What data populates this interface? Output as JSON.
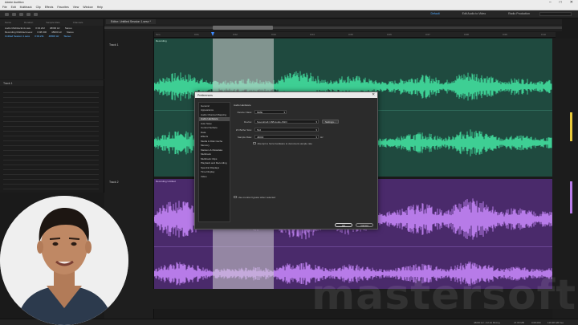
{
  "app": {
    "window_title": "Adobe Audition",
    "menu": [
      "File",
      "Edit",
      "Multitrack",
      "Clip",
      "Effects",
      "Favorites",
      "View",
      "Window",
      "Help"
    ],
    "workspaces": [
      "Default",
      "Edit Audio to Video",
      "Radio Production"
    ]
  },
  "files_panel": {
    "columns": [
      "Name",
      "Duration",
      "Sample Rate",
      "Channels"
    ],
    "rows": [
      {
        "name": "Audio Multitrackmix.wav",
        "duration": "0:04.222",
        "rate": "48000 Hz",
        "channels": "Stereo"
      },
      {
        "name": "Recording Multitrack.sesx",
        "duration": "0:08.000",
        "rate": "48000 Hz",
        "channels": "Stereo"
      },
      {
        "name": "Untitled Session 1.sesx",
        "duration": "0:04.211",
        "rate": "48000 Hz",
        "channels": "Stereo",
        "selected": true
      }
    ]
  },
  "mixer_panel": {
    "title": "Track 1"
  },
  "editor": {
    "tab": "Editor: Untitled Session 1.sesx *",
    "tracks": [
      "Track 1",
      "Track 2"
    ],
    "clips": [
      "Recording",
      "Recording Untitled"
    ],
    "ruler_ticks": [
      "hms",
      "0:01",
      "0:02",
      "0:03",
      "0:04",
      "0:05",
      "0:06",
      "0:07",
      "0:08",
      "0:09",
      "0:10"
    ]
  },
  "preferences": {
    "title": "Preferences",
    "categories": [
      "General",
      "Appearance",
      "Audio Channel Mapping",
      "Audio Hardware",
      "Auto Save",
      "Control Surface",
      "Data",
      "Effects",
      "Media & Disk Cache",
      "Memory",
      "Markers & Metadata",
      "Multitrack",
      "Multitrack Clips",
      "Playback and Recording",
      "Spectral Displays",
      "Time Display",
      "Video"
    ],
    "selected_index": 3,
    "heading": "Audio Hardware",
    "device_class_label": "Device Class:",
    "device_class_value": "MME",
    "device_label": "Device:",
    "device_value": "Soundcraft USB Audio ASIO",
    "settings_button": "Settings...",
    "io_buffer_label": "I/O Buffer Size:",
    "io_buffer_value": "512",
    "sample_rate_label": "Sample Rate:",
    "sample_rate_value": "48000",
    "sample_rate_unit": "Hz",
    "attempt_checkbox": "Attempt to force hardware to document sample rate",
    "bottom_checkbox": "Use monitor bypass when selected",
    "ok_button": "OK",
    "cancel_button": "Cancel"
  },
  "status": {
    "left": "",
    "sample_info": "48000 Hz • 32-bit Mixing",
    "size": "47.95 MB",
    "duration": "0:08.000",
    "free": "116.98 GB free"
  },
  "watermark": "mastersoft",
  "colors": {
    "green_track": "#1f4a3f",
    "green_wave": "#3ecf94",
    "purple_track": "#4a2a6b",
    "purple_wave": "#b77be8",
    "accent": "#3d8bff"
  }
}
